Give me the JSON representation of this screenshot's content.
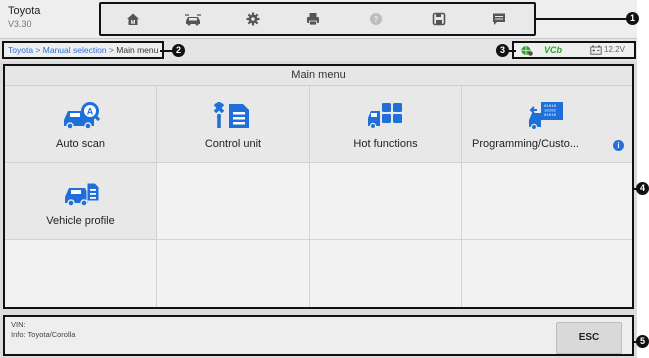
{
  "header": {
    "app_title": "Toyota",
    "version": "V3.30"
  },
  "toolbar": {
    "buttons": [
      {
        "icon": "home-icon"
      },
      {
        "icon": "vehicle-swap-icon"
      },
      {
        "icon": "gear-icon"
      },
      {
        "icon": "printer-icon"
      },
      {
        "icon": "help-icon"
      },
      {
        "icon": "save-icon"
      },
      {
        "icon": "message-icon"
      }
    ]
  },
  "breadcrumb": {
    "items": [
      "Toyota",
      "Manual selection",
      "Main menu"
    ],
    "separator": ">"
  },
  "status": {
    "vci_label": "VCb",
    "voltage": "12.2V"
  },
  "main": {
    "title": "Main menu",
    "tiles": [
      {
        "label": "Auto scan",
        "icon": "auto-scan-icon"
      },
      {
        "label": "Control unit",
        "icon": "control-unit-icon"
      },
      {
        "label": "Hot functions",
        "icon": "hot-functions-icon"
      },
      {
        "label": "Programming/Custo...",
        "icon": "programming-icon",
        "badge": "i"
      },
      {
        "label": "Vehicle profile",
        "icon": "vehicle-profile-icon"
      }
    ]
  },
  "footer": {
    "vin": "VIN:",
    "info": "Info: Toyota/Corolla",
    "esc_label": "ESC"
  },
  "callouts": [
    "1",
    "2",
    "3",
    "4",
    "5"
  ],
  "colors": {
    "accent": "#2a6fd8",
    "icon_blue": "#1e6fd9",
    "vci_green": "#2aa52a"
  }
}
